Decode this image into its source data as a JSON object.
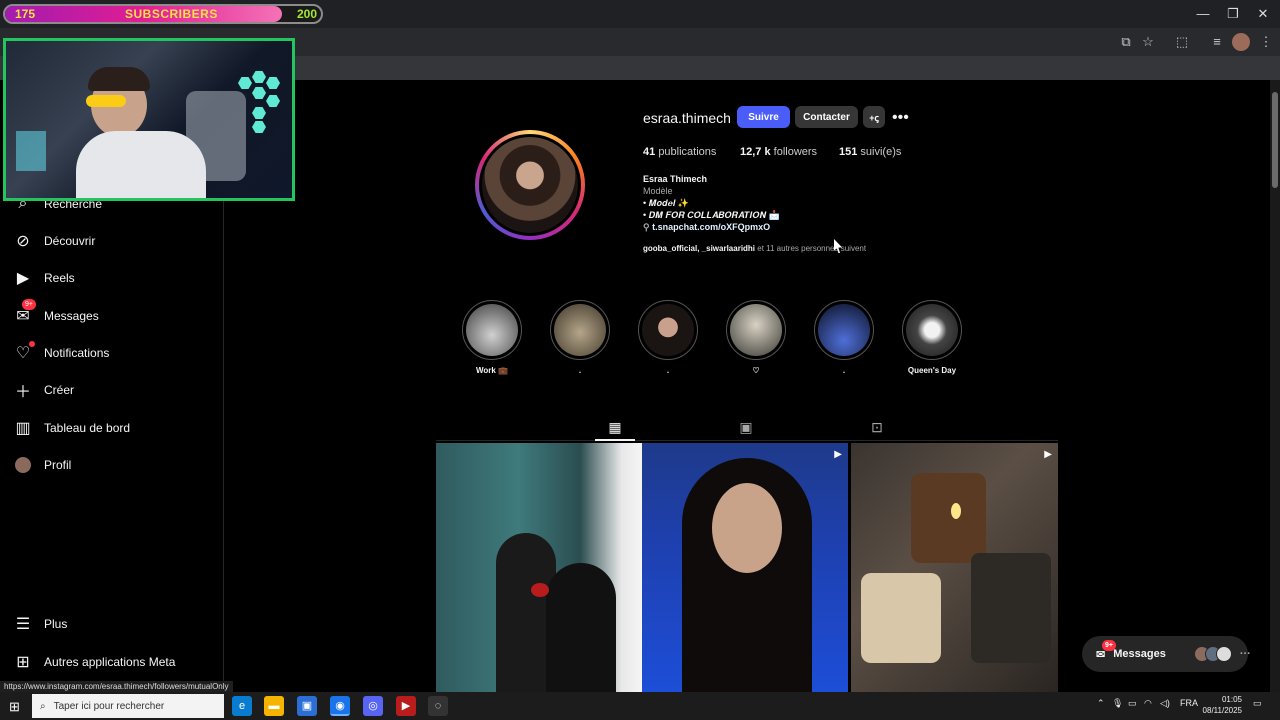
{
  "overlay": {
    "subs_current": "175",
    "subs_label": "SUBSCRIBERS",
    "subs_goal": "200",
    "subs_progress_fraction": 0.875
  },
  "browser": {
    "window_controls": [
      "minimize-icon",
      "restore-icon",
      "close-icon"
    ],
    "toolbar_icons": [
      "cast-icon",
      "star-icon",
      "extensions-icon",
      "media-icon",
      "avatar-icon",
      "more-icon"
    ]
  },
  "sidebar": {
    "items": [
      {
        "label": "Recherche",
        "icon": "search-icon"
      },
      {
        "label": "Découvrir",
        "icon": "compass-icon"
      },
      {
        "label": "Reels",
        "icon": "reels-icon"
      },
      {
        "label": "Messages",
        "icon": "messenger-icon",
        "badge": "9+"
      },
      {
        "label": "Notifications",
        "icon": "heart-icon"
      },
      {
        "label": "Créer",
        "icon": "plus-icon"
      },
      {
        "label": "Tableau de bord",
        "icon": "chart-icon"
      },
      {
        "label": "Profil",
        "icon": "avatar-icon"
      }
    ],
    "bottom_items": [
      {
        "label": "Plus",
        "icon": "menu-icon"
      },
      {
        "label": "Autres applications Meta",
        "icon": "meta-apps-icon"
      }
    ]
  },
  "profile": {
    "username": "esraa.thimech",
    "follow_label": "Suivre",
    "contact_label": "Contacter",
    "stats": {
      "posts_count": "41",
      "posts_label": "publications",
      "followers_count": "12,7 k",
      "followers_label": "followers",
      "following_count": "151",
      "following_label": "suivi(e)s"
    },
    "full_name": "Esraa Thimech",
    "category": "Modèle",
    "bio_line1": "• 𝑴𝒐𝒅𝒆𝒍 ✨",
    "bio_line2": "• 𝑫𝑴 𝑭𝑶𝑹 𝑪𝑶𝑳𝑳𝑨𝑩𝑶𝑹𝑨𝑻𝑰𝑶𝑵 📩",
    "link": "t.snapchat.com/oXFQpmxO",
    "followed_by_names": "gooba_official, _siwarlaaridhi",
    "followed_by_rest": " et 11 autres personnes suivent"
  },
  "highlights": [
    {
      "label": "Work 💼",
      "color": "#8a8a8a"
    },
    {
      "label": ".",
      "color": "#6b6355"
    },
    {
      "label": ".",
      "color": "#5b4a44"
    },
    {
      "label": "♡",
      "color": "#7a7a70"
    },
    {
      "label": ".",
      "color": "#1f2a4a"
    },
    {
      "label": "Queen's Day",
      "color": "#9a9a9a"
    }
  ],
  "tabs": [
    "grid-icon",
    "reels-tab-icon",
    "tagged-icon"
  ],
  "posts": [
    {
      "name": "post-couple-roses",
      "has_video": false
    },
    {
      "name": "post-portrait-video",
      "has_video": true
    },
    {
      "name": "post-candles-video",
      "has_video": true
    }
  ],
  "messages_pill": {
    "label": "Messages",
    "badge": "9+"
  },
  "status_url": "https://www.instagram.com/esraa.thimech/followers/mutualOnly",
  "taskbar": {
    "search_placeholder": "Taper ici pour rechercher",
    "language": "FRA",
    "time": "01:05",
    "date": "08/11/2025"
  }
}
